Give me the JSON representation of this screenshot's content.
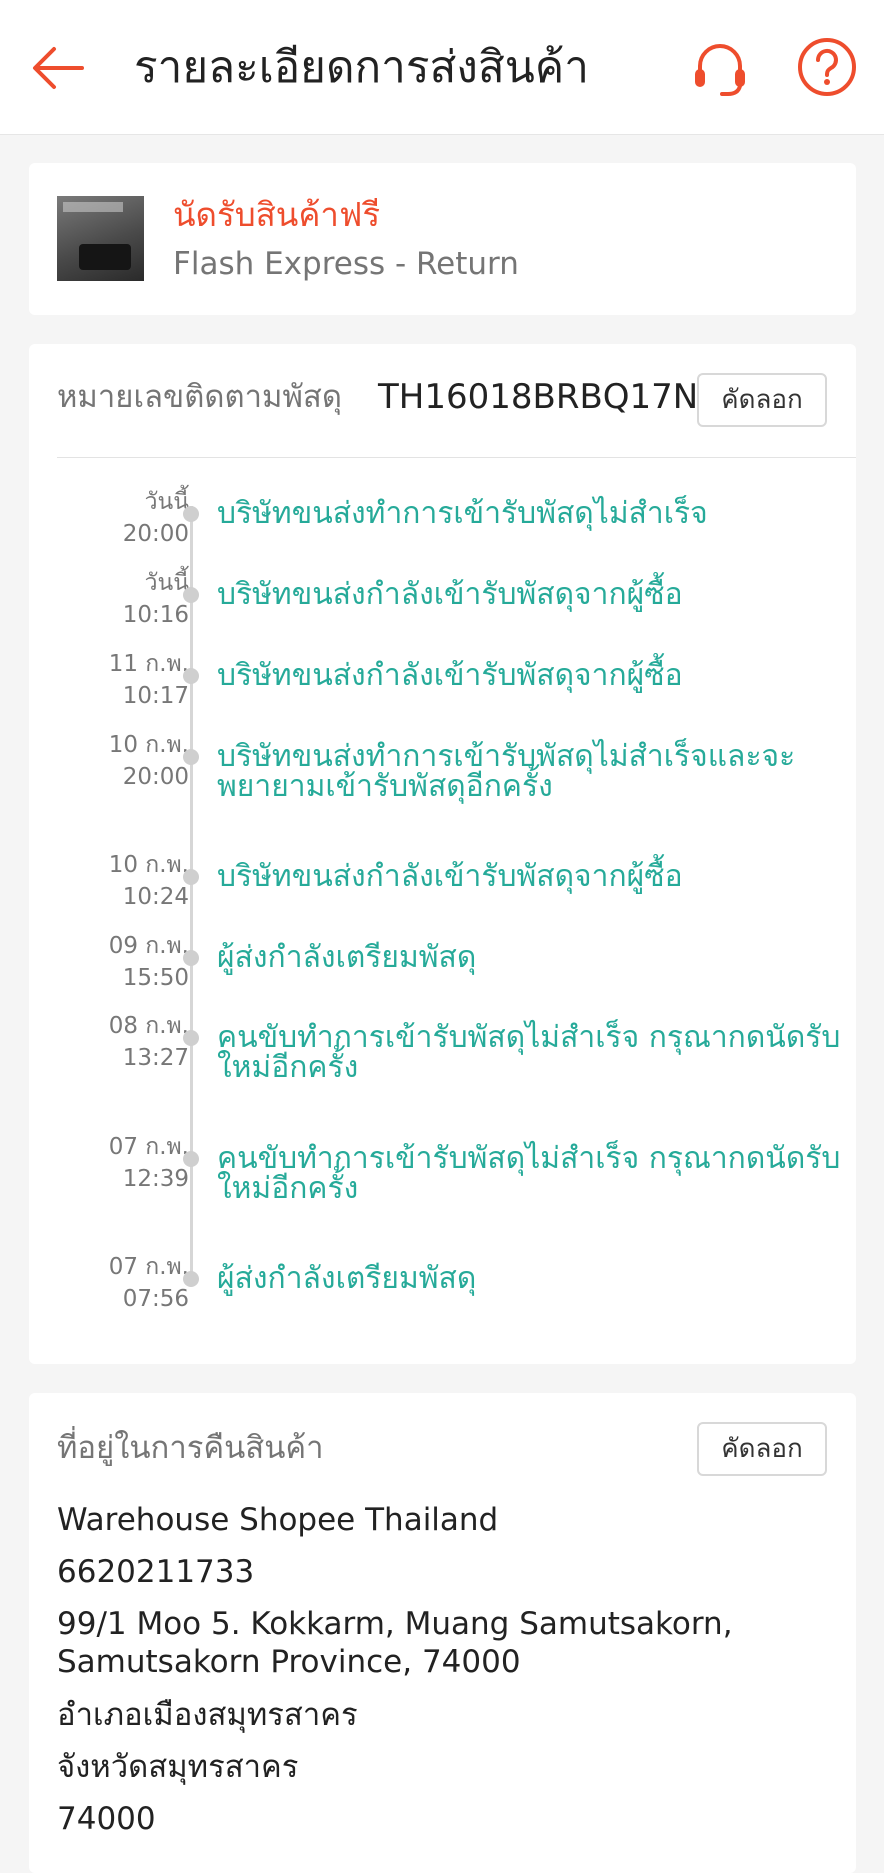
{
  "header": {
    "title": "รายละเอียดการส่งสินค้า",
    "back_icon": "arrow-left-icon",
    "headset_icon": "headset-icon",
    "help_icon": "question-circle-icon",
    "accent_color": "#ee4d2d"
  },
  "pickup": {
    "title": "นัดรับสินค้าฟรี",
    "carrier": "Flash Express - Return"
  },
  "tracking": {
    "label": "หมายเลขติดตามพัสดุ",
    "number": "TH16018BRBQ17N",
    "copy_label": "คัดลอก",
    "status_color": "#26aa99",
    "events": [
      {
        "date": "วันนี้",
        "time": "20:00",
        "text": "บริษัทขนส่งทำการเข้ารับพัสดุไม่สำเร็จ"
      },
      {
        "date": "วันนี้",
        "time": "10:16",
        "text": "บริษัทขนส่งกำลังเข้ารับพัสดุจากผู้ซื้อ"
      },
      {
        "date": "11 ก.พ.",
        "time": "10:17",
        "text": "บริษัทขนส่งกำลังเข้ารับพัสดุจากผู้ซื้อ"
      },
      {
        "date": "10 ก.พ.",
        "time": "20:00",
        "text": "บริษัทขนส่งทำการเข้ารับพัสดุไม่สำเร็จและจะพยายามเข้ารับพัสดุอีกครั้ง"
      },
      {
        "date": "10 ก.พ.",
        "time": "10:24",
        "text": "บริษัทขนส่งกำลังเข้ารับพัสดุจากผู้ซื้อ"
      },
      {
        "date": "09 ก.พ.",
        "time": "15:50",
        "text": "ผู้ส่งกำลังเตรียมพัสดุ"
      },
      {
        "date": "08 ก.พ.",
        "time": "13:27",
        "text": "คนขับทำการเข้ารับพัสดุไม่สำเร็จ กรุณากดนัดรับใหม่อีกครั้ง"
      },
      {
        "date": "07 ก.พ.",
        "time": "12:39",
        "text": "คนขับทำการเข้ารับพัสดุไม่สำเร็จ กรุณากดนัดรับใหม่อีกครั้ง"
      },
      {
        "date": "07 ก.พ.",
        "time": "07:56",
        "text": "ผู้ส่งกำลังเตรียมพัสดุ"
      }
    ]
  },
  "return_address": {
    "label": "ที่อยู่ในการคืนสินค้า",
    "copy_label": "คัดลอก",
    "name": "Warehouse Shopee Thailand",
    "phone": "6620211733",
    "street": "99/1 Moo 5. Kokkarm, Muang Samutsakorn, Samutsakorn Province, 74000",
    "district": "อำเภอเมืองสมุทรสาคร",
    "province": "จังหวัดสมุทรสาคร",
    "postcode": "74000"
  }
}
